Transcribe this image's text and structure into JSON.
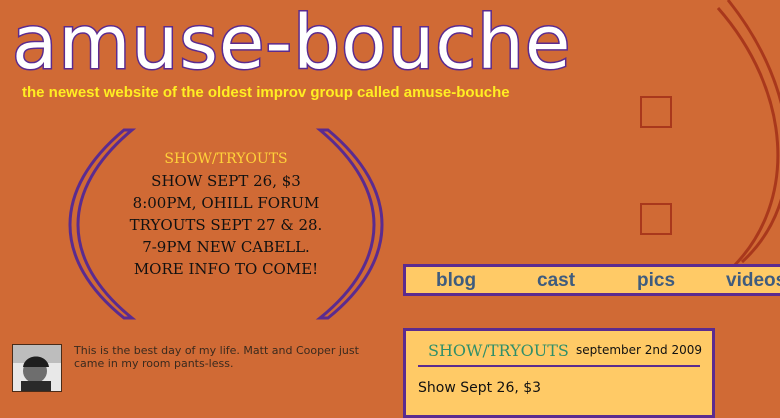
{
  "site": {
    "logo": "amuse-bouche",
    "tagline": "the newest website of the oldest improv group called amuse-bouche"
  },
  "announcement": {
    "heading": "SHOW/TRYOUTS",
    "lines": [
      "SHOW SEPT 26, $3",
      "8:00PM, OHILL FORUM",
      "TRYOUTS SEPT 27 & 28.",
      "7-9PM NEW CABELL.",
      "MORE INFO TO COME!"
    ]
  },
  "nav": {
    "items": [
      {
        "label": "blog"
      },
      {
        "label": "cast"
      },
      {
        "label": "pics"
      },
      {
        "label": "videos"
      }
    ]
  },
  "post": {
    "title": "SHOW/TRYOUTS",
    "date": "september 2nd 2009",
    "body": "Show Sept 26, $3"
  },
  "status": {
    "text": "This is the best day of my life. Matt and Cooper just came in my room pants-less."
  },
  "colors": {
    "background": "#d06a35",
    "accent_purple": "#5b2b8f",
    "panel": "#ffca66",
    "tagline": "#ffee22"
  }
}
